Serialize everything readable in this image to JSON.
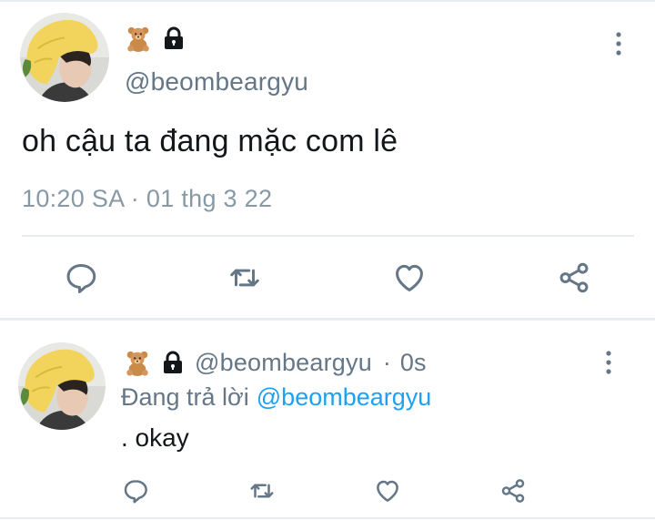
{
  "main_tweet": {
    "handle": "@beombeargyu",
    "badges": [
      "bear-emoji",
      "lock-icon"
    ],
    "text": "oh cậu ta đang mặc com lê",
    "timestamp": "10:20 SA · 01 thg 3 22",
    "actions": [
      "reply-icon",
      "retweet-icon",
      "like-icon",
      "share-icon"
    ]
  },
  "reply_tweet": {
    "handle": "@beombeargyu",
    "separator": "·",
    "time": "0s",
    "replying_label": "Đang trả lời",
    "replying_to": "@beombeargyu",
    "text": ". okay",
    "actions": [
      "reply-icon",
      "retweet-icon",
      "like-icon",
      "share-icon"
    ]
  },
  "colors": {
    "text_primary": "#14171a",
    "text_secondary": "#657786",
    "timestamp": "#8899a6",
    "icon": "#657786",
    "link": "#1da1f2",
    "divider": "#e6ecf0"
  }
}
